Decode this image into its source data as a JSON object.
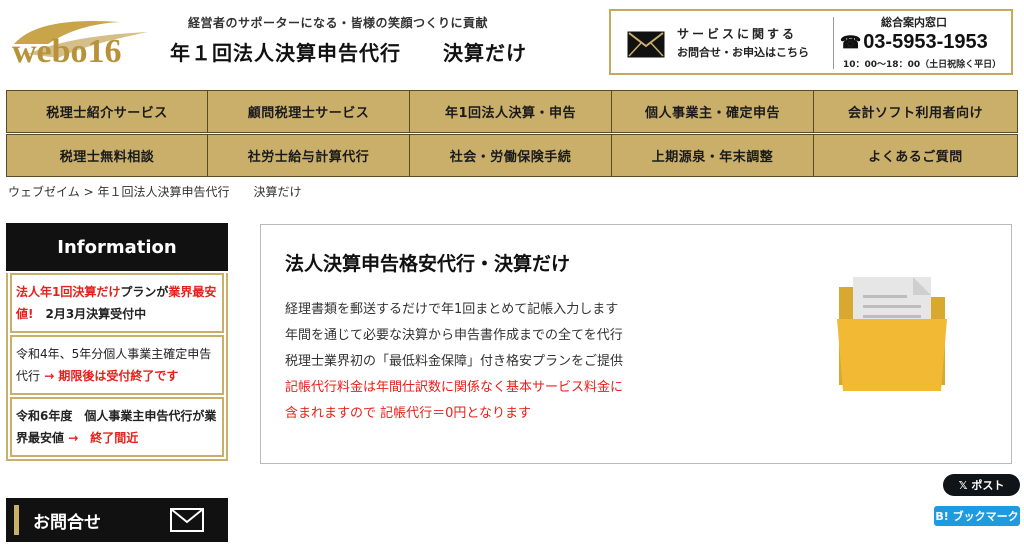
{
  "header": {
    "logo_text": "webo16",
    "tagline": "経営者のサポーターになる・皆様の笑顔つくりに貢献",
    "title": "年１回法人決算申告代行　　決算だけ",
    "contact": {
      "service_text": "サービスに関する",
      "inquiry_text": "お問合せ・お申込はこちら",
      "phone_label": "総合案内窓口",
      "phone_number": "03-5953-1953",
      "phone_icon": "☎",
      "hours": "10：00～18：00（土日祝除く平日）"
    }
  },
  "nav": {
    "row1": [
      "税理士紹介サービス",
      "顧問税理士サービス",
      "年1回法人決算・申告",
      "個人事業主・確定申告",
      "会計ソフト利用者向け"
    ],
    "row2": [
      "税理士無料相談",
      "社労士給与計算代行",
      "社会・労働保険手続",
      "上期源泉・年末調整",
      "よくあるご質問"
    ]
  },
  "breadcrumb": "ウェブゼイム > 年１回法人決算申告代行　　決算だけ",
  "sidebar": {
    "info_title": "Information",
    "items": [
      {
        "red1": "法人年1回決算だけ",
        "black1": "プランが",
        "red2": "業界最安値!",
        "black2": "　2月3月決算受付中"
      },
      {
        "normal": "令和4年、5年分個人事業主確定申告代行",
        "red": " → 期限後は受付終了です"
      },
      {
        "black": "令和6年度　個人事業主申告代行が業界最安値",
        "red": " →　終了間近"
      }
    ],
    "contact_label": "お問合せ"
  },
  "main": {
    "title": "法人決算申告格安代行・決算だけ",
    "lines": [
      "経理書類を郵送するだけで年1回まとめて記帳入力します",
      "年間を通じて必要な決算から申告書作成までの全てを代行",
      "税理士業界初の「最低料金保障」付き格安プランをご提供"
    ],
    "red_lines": [
      "記帳代行料金は年間仕訳数に関係なく基本サービス料金に",
      "含まれますので 記帳代行＝0円となります"
    ]
  },
  "social": {
    "x_post": "𝕏 ポスト",
    "hatena": "B! ブックマーク"
  },
  "colors": {
    "gold": "#c9af6a",
    "dark": "#111111",
    "red": "#e8201a",
    "hatena_blue": "#1e9be0"
  }
}
